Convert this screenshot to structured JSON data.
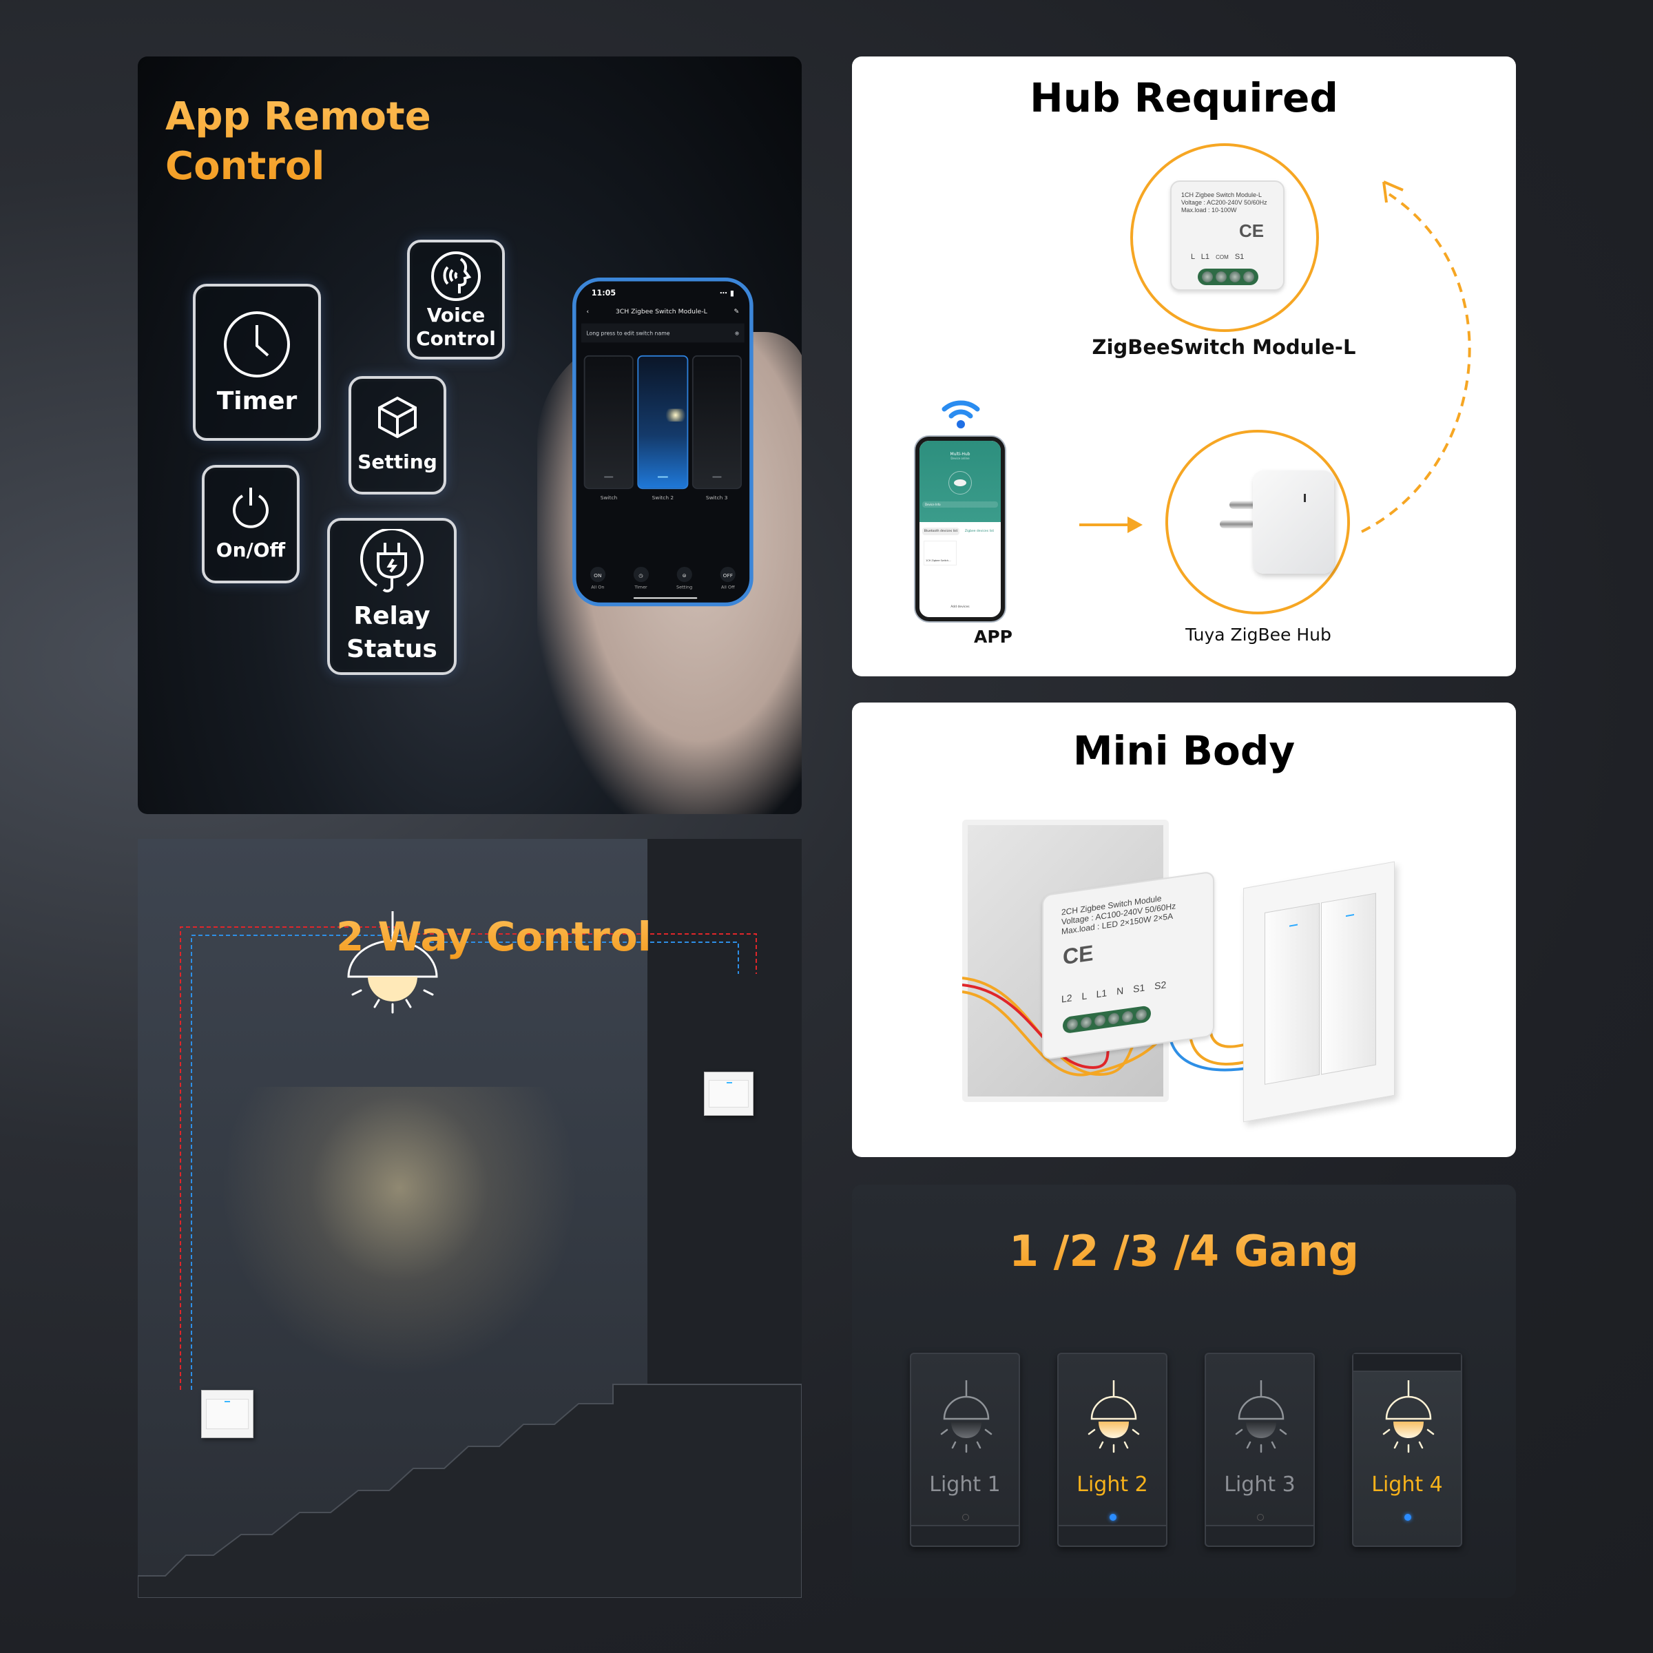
{
  "panels": {
    "app_remote": {
      "title_line1": "App Remote",
      "title_line2": "Control",
      "features": [
        {
          "label": "Timer",
          "icon": "clock-icon"
        },
        {
          "label_line1": "Voice",
          "label_line2": "Control",
          "icon": "voice-icon"
        },
        {
          "label": "Setting",
          "icon": "cube-icon"
        },
        {
          "label": "On/Off",
          "icon": "power-icon"
        },
        {
          "label_line1": "Relay",
          "label_line2": "Status",
          "icon": "plug-icon"
        }
      ],
      "phone": {
        "time": "11:05",
        "title": "3CH Zigbee Switch Module-L",
        "hint": "Long press to edit switch name",
        "switches": [
          {
            "name": "Switch",
            "on": false
          },
          {
            "name": "Switch 2",
            "on": true
          },
          {
            "name": "Switch 3",
            "on": false
          }
        ],
        "bottom_buttons": [
          {
            "icon_text": "ON",
            "label": "All On"
          },
          {
            "icon_text": "◷",
            "label": "Timer"
          },
          {
            "icon_text": "⊜",
            "label": "Setting"
          },
          {
            "icon_text": "OFF",
            "label": "All Off"
          }
        ]
      }
    },
    "hub": {
      "title": "Hub Required",
      "module_caption": "ZigBeeSwitch Module-L",
      "module_label": [
        "1CH Zigbee Switch Module-L",
        "Voltage : AC200-240V 50/60Hz",
        "Max.load : 10-100W"
      ],
      "module_terminals": [
        "L",
        "L1",
        "COM",
        "S1"
      ],
      "hub_caption": "Tuya ZigBee Hub",
      "app_caption": "APP",
      "app_screen": {
        "title": "Multi-Hub",
        "subtitle": "Device online",
        "device_info": "Device Info",
        "tab_bluetooth": "Bluetooth devices list",
        "tab_zigbee": "Zigbee devices list",
        "card": "1CH Zigbee Switch...",
        "add": "Add devices"
      },
      "accent": "#f6a623"
    },
    "mini": {
      "title": "Mini Body",
      "module_label": [
        "2CH Zigbee Switch Module",
        "Voltage : AC100-240V 50/60Hz",
        "Max.load : LED 2×150W 2×5A"
      ],
      "module_terminals": [
        "L2",
        "L",
        "L1",
        "N",
        "S1",
        "S2"
      ]
    },
    "two_way": {
      "title": "2 Way Control"
    },
    "gang": {
      "title": "1 /2 /3 /4 Gang",
      "switches": [
        {
          "label": "Light 1",
          "on": false
        },
        {
          "label": "Light 2",
          "on": true
        },
        {
          "label": "Light 3",
          "on": false
        },
        {
          "label": "Light 4",
          "on": true
        }
      ]
    }
  },
  "colors": {
    "orange": "#fba93a",
    "led_blue": "#2b8cff",
    "wire_red": "#e0262a",
    "wire_blue": "#2e8fe6"
  }
}
